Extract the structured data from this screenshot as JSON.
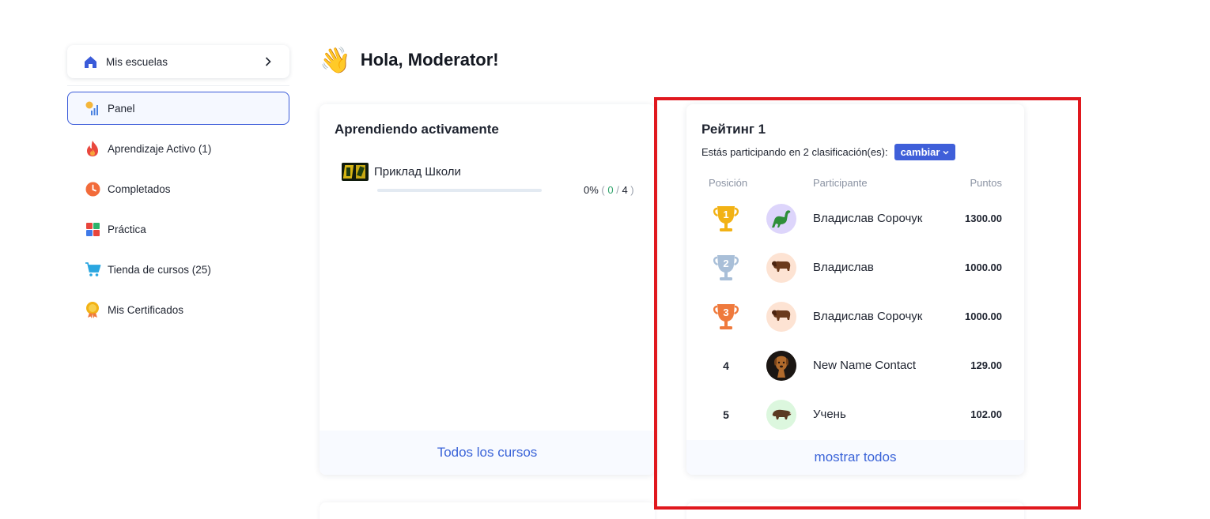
{
  "sidebar": {
    "schools_label": "Mis escuelas",
    "items": [
      {
        "label": "Panel",
        "icon": "dashboard-chart-icon",
        "active": true
      },
      {
        "label": "Aprendizaje Activo (1)",
        "icon": "fire-icon",
        "active": false
      },
      {
        "label": "Completados",
        "icon": "clock-icon",
        "active": false
      },
      {
        "label": "Práctica",
        "icon": "blocks-icon",
        "active": false
      },
      {
        "label": "Tienda de cursos (25)",
        "icon": "cart-icon",
        "active": false
      },
      {
        "label": "Mis Certificados",
        "icon": "medal-icon",
        "active": false
      }
    ]
  },
  "greeting": {
    "emoji": "👋",
    "text": "Hola, Moderator!"
  },
  "active_learning": {
    "title": "Aprendiendo activamente",
    "courses": [
      {
        "name": "Приклад Школи",
        "progress_percent": "0%",
        "completed": "0",
        "total": "4",
        "progress_fraction": 0
      }
    ],
    "footer_link": "Todos los cursos"
  },
  "rating": {
    "title": "Рейтинг 1",
    "subtitle": "Estás participando en 2 clasificación(es):",
    "change_label": "cambiar",
    "columns": {
      "position": "Posición",
      "participant": "Participante",
      "points": "Puntos"
    },
    "rows": [
      {
        "rank": "1",
        "name": "Владислав Сорочук",
        "points": "1300.00",
        "avatar": "dinosaur-icon",
        "trophy": "gold"
      },
      {
        "rank": "2",
        "name": "Владислав",
        "points": "1000.00",
        "avatar": "bison-icon",
        "trophy": "silver"
      },
      {
        "rank": "3",
        "name": "Владислав Сорочук",
        "points": "1000.00",
        "avatar": "bison-icon",
        "trophy": "bronze"
      },
      {
        "rank": "4",
        "name": "New Name Contact",
        "points": "129.00",
        "avatar": "dog-photo",
        "trophy": ""
      },
      {
        "rank": "5",
        "name": "Учень",
        "points": "102.00",
        "avatar": "boar-icon",
        "trophy": ""
      }
    ],
    "footer_link": "mostrar todos"
  },
  "colors": {
    "accent": "#3a5bd9",
    "link": "#3a63d8",
    "button": "#3f5fd9",
    "gold": "#f2b215",
    "silver": "#a9bfd8",
    "bronze": "#ef7a3d",
    "highlight": "#e0181e"
  }
}
